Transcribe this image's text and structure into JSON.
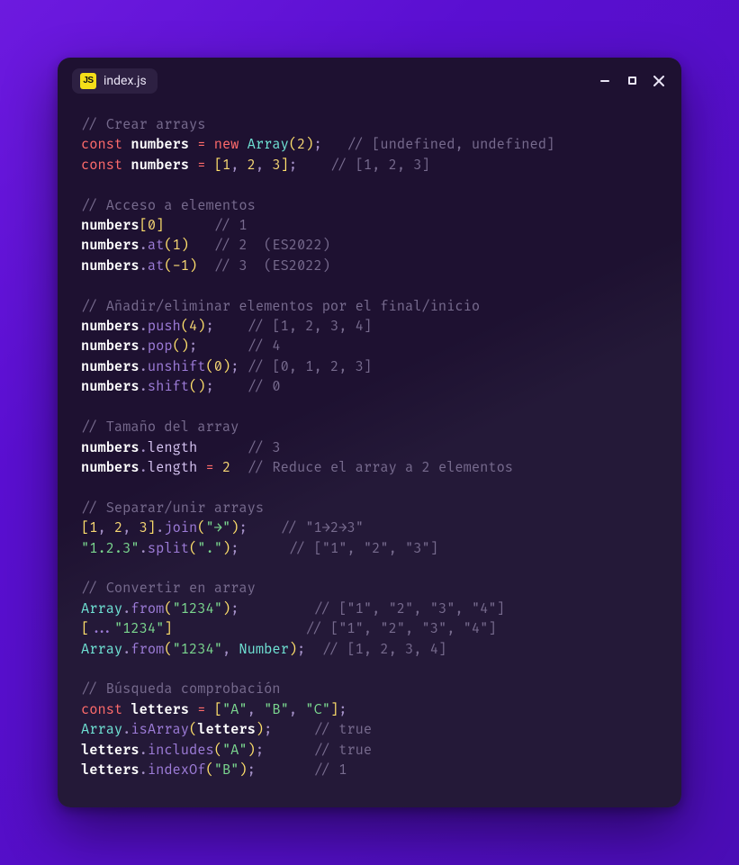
{
  "tab": {
    "badge": "JS",
    "filename": "index.js"
  },
  "code": {
    "c_crear": "// Crear arrays",
    "kw_const": "const",
    "id_numbers": "numbers",
    "op_eq": "=",
    "kw_new": "new",
    "cl_Array": "Array",
    "n2": "2",
    "c_undef": "// [undefined, undefined]",
    "n1": "1",
    "n3": "3",
    "c_123": "// [1, 2, 3]",
    "c_acc": "// Acceso a elementos",
    "n0": "0",
    "c_a1": "// 1",
    "m_at": "at",
    "c_a2": "// 2  (ES2022)",
    "n_m1": "-1",
    "c_a3": "// 3  (ES2022)",
    "c_add": "// Añadir/eliminar elementos por el final/inicio",
    "m_push": "push",
    "n4": "4",
    "c_p1234": "// [1, 2, 3, 4]",
    "m_pop": "pop",
    "c_r4": "// 4",
    "m_unshift": "unshift",
    "c_0123": "// [0, 1, 2, 3]",
    "m_shift": "shift",
    "c_r0": "// 0",
    "c_size": "// Tamaño del array",
    "p_length": "length",
    "c_l3": "// 3",
    "c_lred": "// Reduce el array a 2 elementos",
    "c_sep": "// Separar/unir arrays",
    "m_join": "join",
    "s_arrow": "\"→\"",
    "c_join": "// \"1→2→3\"",
    "s_123": "\"1.2.3\"",
    "m_split": "split",
    "s_dot": "\".\"",
    "c_split": "// [\"1\", \"2\", \"3\"]",
    "c_conv": "// Convertir en array",
    "m_from": "from",
    "s_1234": "\"1234\"",
    "c_f1": "// [\"1\", \"2\", \"3\", \"4\"]",
    "c_f2": "// [\"1\", \"2\", \"3\", \"4\"]",
    "cl_Number": "Number",
    "c_f3": "// [1, 2, 3, 4]",
    "c_search": "// Búsqueda comprobación",
    "id_letters": "letters",
    "s_A": "\"A\"",
    "s_B": "\"B\"",
    "s_C": "\"C\"",
    "m_isArray": "isArray",
    "c_true1": "// true",
    "m_includes": "includes",
    "c_true2": "// true",
    "m_indexOf": "indexOf",
    "c_idx1": "// 1"
  }
}
